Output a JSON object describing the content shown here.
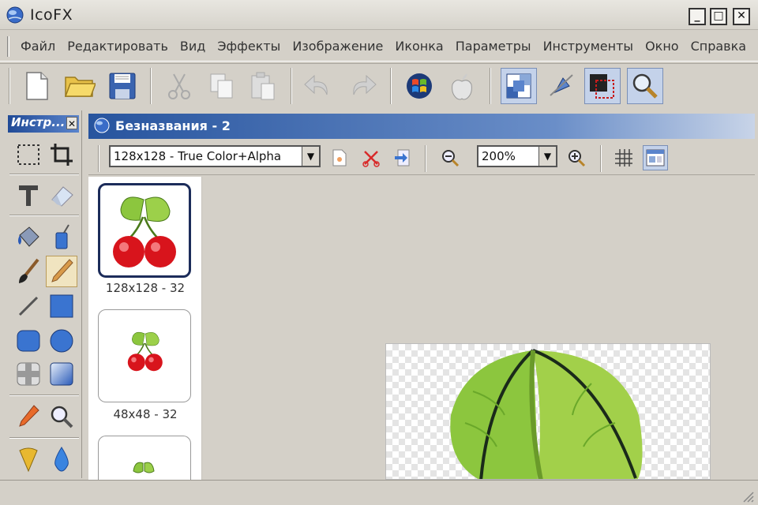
{
  "window": {
    "title": "IcoFX",
    "min_label": "_",
    "max_label": "□",
    "close_label": "✕"
  },
  "menu": {
    "items": [
      "Файл",
      "Редактировать",
      "Вид",
      "Эффекты",
      "Изображение",
      "Иконка",
      "Параметры",
      "Инструменты",
      "Окно",
      "Справка"
    ]
  },
  "toolbar": {
    "buttons": [
      "new-file",
      "open-folder",
      "save",
      "cut",
      "copy",
      "paste",
      "undo",
      "redo",
      "windows-logo",
      "apple-logo",
      "preview",
      "no-cursor",
      "hotspot",
      "magnifier"
    ]
  },
  "tools_panel": {
    "title": "Инстр...",
    "close_label": "✕"
  },
  "document": {
    "title": "Безназвания - 2",
    "format_select": "128x128 - True Color+Alpha",
    "zoom_select": "200%",
    "thumbnails": [
      {
        "label": "128x128 - 32",
        "selected": true
      },
      {
        "label": "48x48 - 32",
        "selected": false
      },
      {
        "label": "",
        "selected": false
      }
    ]
  },
  "colors": {
    "accent": "#27549e",
    "leaf": "#8cc63e",
    "cherry": "#d8141c"
  }
}
